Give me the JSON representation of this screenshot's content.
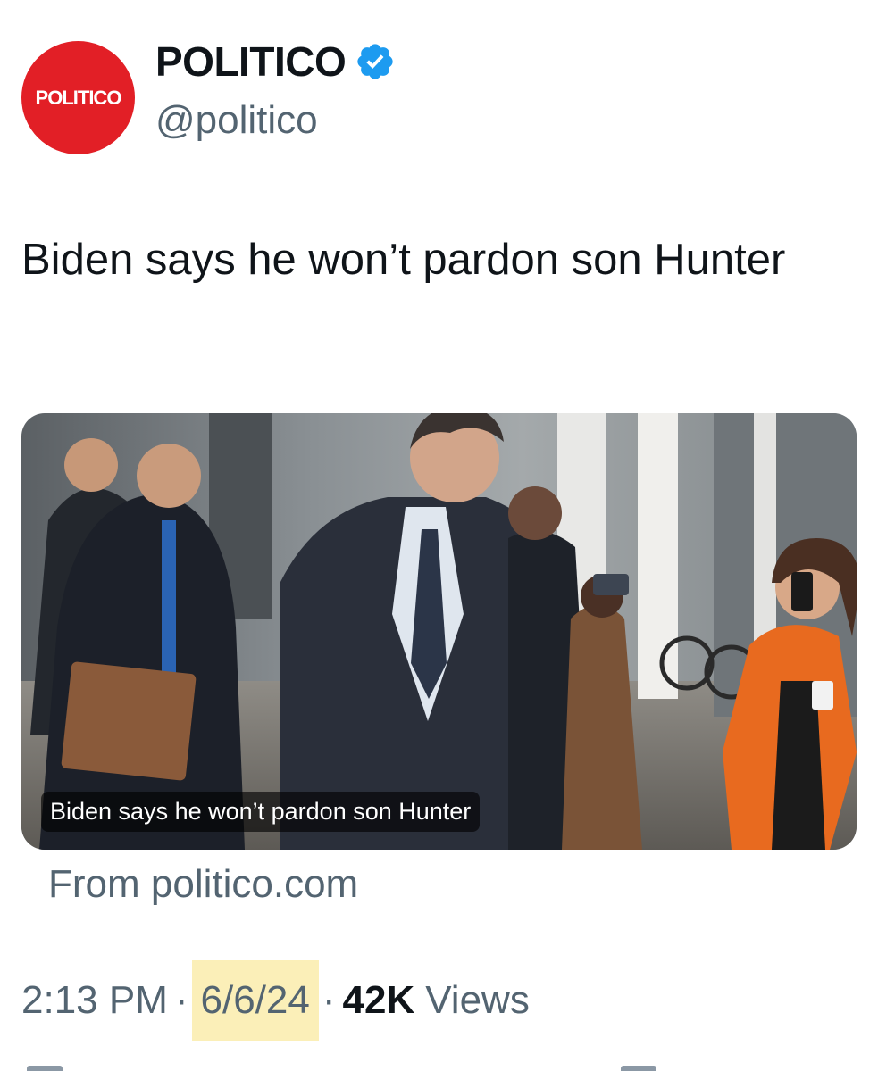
{
  "account": {
    "avatar_text": "POLITICO",
    "display_name": "POLITICO",
    "handle": "@politico",
    "verified": true,
    "verified_icon": "verified-badge-icon",
    "brand_color": "#e21f26",
    "verified_color": "#1d9bf0"
  },
  "tweet": {
    "text": "Biden says he won’t pardon son Hunter"
  },
  "card": {
    "caption": "Biden says he won’t pardon son Hunter",
    "source": "From politico.com"
  },
  "meta": {
    "time": "2:13 PM",
    "separator": "·",
    "date": "6/6/24",
    "views_count": "42K",
    "views_label": "Views",
    "highlight_color": "#fbefb8"
  }
}
